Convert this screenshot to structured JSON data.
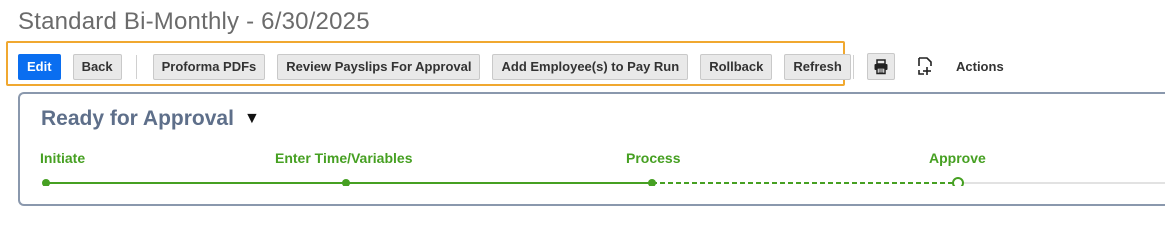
{
  "page": {
    "title": "Standard Bi-Monthly - 6/30/2025"
  },
  "toolbar": {
    "buttons": [
      {
        "label": "Edit",
        "primary": true
      },
      {
        "label": "Back"
      },
      {
        "label": "Proforma PDFs"
      },
      {
        "label": "Review Payslips For Approval"
      },
      {
        "label": "Add Employee(s) to Pay Run"
      },
      {
        "label": "Rollback"
      },
      {
        "label": "Refresh"
      }
    ],
    "print_icon": "printer-icon",
    "actions_icon": "add-document-icon",
    "actions_label": "Actions"
  },
  "status": {
    "title": "Ready for Approval",
    "caret": "▼",
    "steps": [
      {
        "label": "Initiate",
        "state": "complete"
      },
      {
        "label": "Enter Time/Variables",
        "state": "complete"
      },
      {
        "label": "Process",
        "state": "complete"
      },
      {
        "label": "Approve",
        "state": "current"
      }
    ]
  },
  "colors": {
    "primary": "#0a6ef0",
    "highlight": "#f0a830",
    "step_green": "#46a022",
    "status_title": "#5e6f8a",
    "card_border": "#8a98ad"
  }
}
